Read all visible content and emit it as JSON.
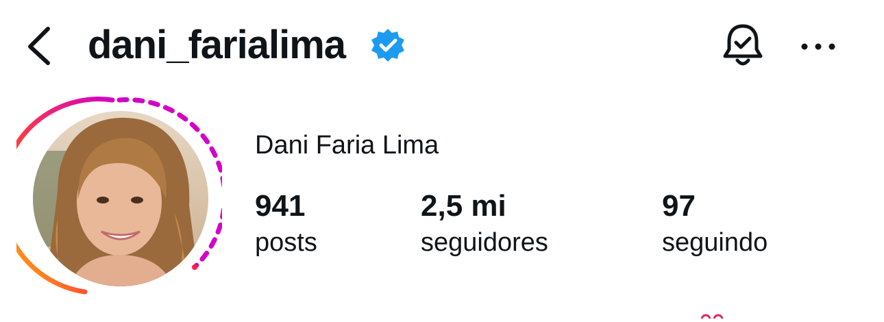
{
  "header": {
    "username": "dani_farialima",
    "back_icon": "chevron-left-icon",
    "verified_icon": "verified-badge-icon",
    "notify_icon": "bell-check-icon",
    "more_icon": "more-horizontal-icon"
  },
  "profile": {
    "avatar_icon": "profile-photo",
    "display_name": "Dani Faria Lima",
    "stats": {
      "posts": {
        "value": "941",
        "label": "posts"
      },
      "followers": {
        "value": "2,5 mi",
        "label": "seguidores"
      },
      "following": {
        "value": "97",
        "label": "seguindo"
      }
    }
  },
  "colors": {
    "text": "#0f1419",
    "verified": "#1d9bf0",
    "ring_gradient_start": "#ffc107",
    "ring_gradient_mid": "#ff3d3d",
    "ring_gradient_end": "#d300c5"
  }
}
